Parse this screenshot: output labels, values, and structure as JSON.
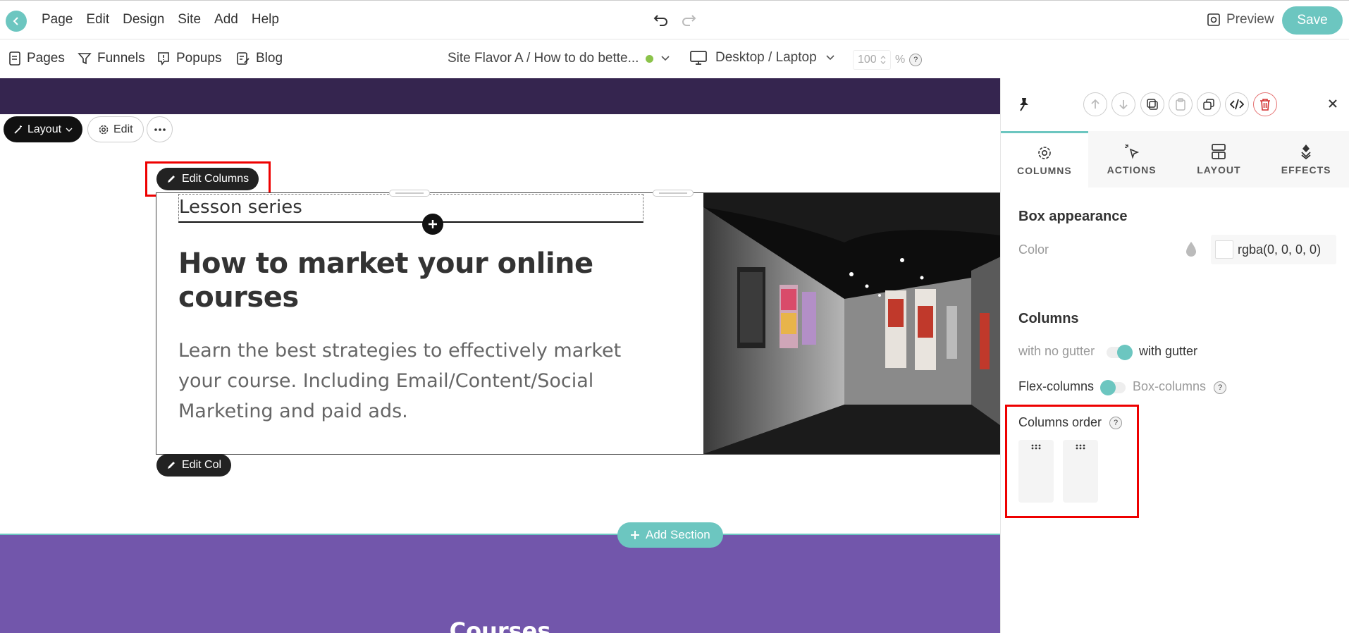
{
  "topbar": {
    "menu": [
      "Page",
      "Edit",
      "Design",
      "Site",
      "Add",
      "Help"
    ],
    "preview_label": "Preview",
    "save_label": "Save"
  },
  "subbar": {
    "pages": "Pages",
    "funnels": "Funnels",
    "popups": "Popups",
    "blog": "Blog",
    "site_flavor": "Site Flavor A / How to do bette...",
    "device": "Desktop / Laptop",
    "zoom_value": "100",
    "zoom_unit": "%",
    "help": "?"
  },
  "canvas": {
    "layout_label": "Layout",
    "edit_label": "Edit",
    "edit_columns_label": "Edit Columns",
    "edit_col_label": "Edit Col",
    "subtitle": "Lesson series",
    "headline": "How to market your online courses",
    "body": "Learn the best strategies to effectively market your course. Including Email/Content/Social Marketing and paid ads.",
    "add_section_label": "Add Section",
    "courses_title": "Courses"
  },
  "panel": {
    "tabs": [
      "COLUMNS",
      "ACTIONS",
      "LAYOUT",
      "EFFECTS"
    ],
    "box_appearance": "Box appearance",
    "color_label": "Color",
    "color_value": "rgba(0, 0, 0, 0)",
    "columns_heading": "Columns",
    "no_gutter": "with no gutter",
    "with_gutter": "with gutter",
    "flex_columns": "Flex-columns",
    "box_columns": "Box-columns",
    "columns_order": "Columns order",
    "help": "?"
  },
  "colors": {
    "accent": "#6cc6c0",
    "dark_band": "#35254f",
    "purple_band": "#7256ab",
    "highlight": "#ee0000"
  }
}
